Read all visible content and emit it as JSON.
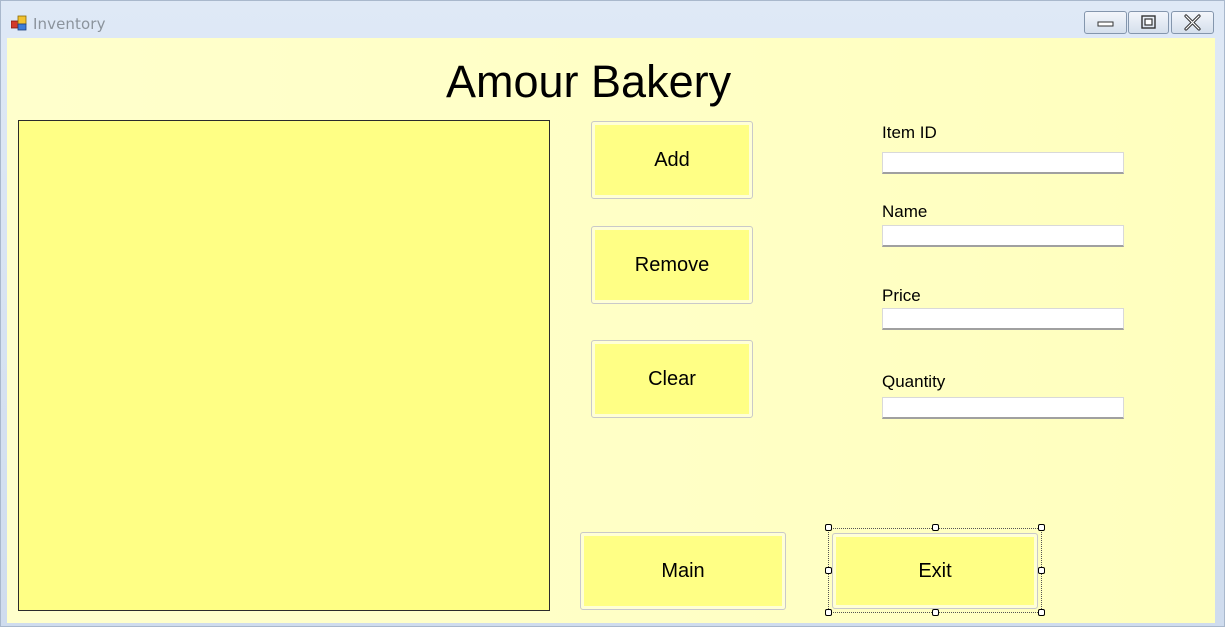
{
  "window": {
    "title": "Inventory",
    "controls": {
      "minimize": "minimize-icon",
      "maximize": "maximize-icon",
      "close": "close-icon"
    }
  },
  "header": {
    "title": "Amour Bakery"
  },
  "inventory_list": {
    "items": []
  },
  "actions": {
    "add_label": "Add",
    "remove_label": "Remove",
    "clear_label": "Clear",
    "main_label": "Main",
    "exit_label": "Exit"
  },
  "form": {
    "item_id": {
      "label": "Item ID",
      "value": ""
    },
    "name": {
      "label": "Name",
      "value": ""
    },
    "price": {
      "label": "Price",
      "value": ""
    },
    "quantity": {
      "label": "Quantity",
      "value": ""
    }
  },
  "colors": {
    "form_background": "#ffffcc",
    "control_fill": "#ffff85",
    "text": "#000000"
  }
}
